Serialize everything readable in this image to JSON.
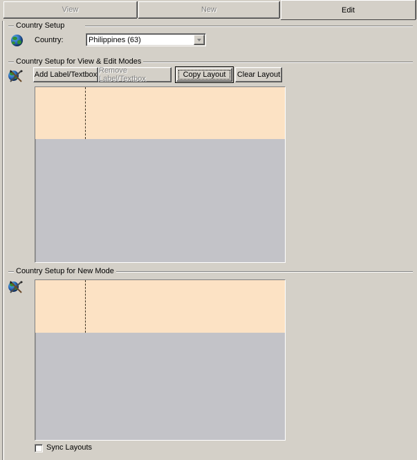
{
  "tabs": [
    {
      "label": "View",
      "state": "inactive"
    },
    {
      "label": "New",
      "state": "inactive"
    },
    {
      "label": "Edit",
      "state": "active"
    }
  ],
  "country_setup": {
    "legend": "Country Setup",
    "icon": "globe-icon",
    "country_label": "Country:",
    "country_value": "Philippines (63)",
    "country_placeholder": "Philippines (63)"
  },
  "view_edit_group": {
    "legend": "Country Setup for View & Edit Modes",
    "icon": "globe-edit-icon",
    "buttons": [
      {
        "label": "Add Label/Textbox",
        "state": "enabled"
      },
      {
        "label": "Remove Label/Textbox",
        "state": "disabled"
      },
      {
        "label": "Copy Layout",
        "state": "default-focused"
      },
      {
        "label": "Clear Layout",
        "state": "enabled"
      }
    ]
  },
  "new_mode_group": {
    "legend": "Country Setup for New Mode",
    "icon": "globe-edit-icon"
  },
  "footer": {
    "sync_layouts_label": "Sync Layouts",
    "sync_layouts_checked": false
  },
  "colors": {
    "window_face": "#d4d0c8",
    "canvas_field": "#c3c3c8",
    "canvas_peach": "#fce2c4",
    "divider_dash": "#3a3020",
    "disabled_text": "#808080"
  }
}
